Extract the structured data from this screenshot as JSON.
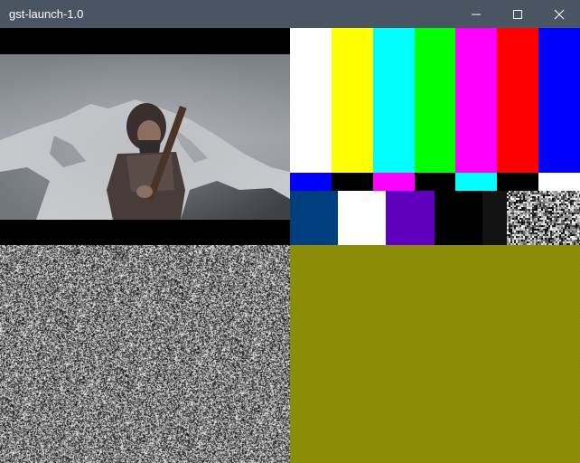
{
  "window": {
    "title": "gst-launch-1.0",
    "controls": [
      "minimize-icon",
      "maximize-icon",
      "close-icon"
    ]
  },
  "video_grid": {
    "top_left": {
      "content": "movie-frame",
      "letterbox": "black"
    },
    "top_right": {
      "content": "smpte-color-bars",
      "top_bars": [
        "#ffffff",
        "#ffff00",
        "#00ffff",
        "#00ff00",
        "#ff00ff",
        "#ff0000",
        "#0000ff"
      ],
      "middle_bars": [
        "#0000ff",
        "#000000",
        "#ff00ff",
        "#000000",
        "#00ffff",
        "#000000",
        "#ffffff"
      ],
      "bottom_bars": [
        "#003f7f",
        "#ffffff",
        "#5f00bf",
        "#000000",
        "#131313",
        "noise"
      ]
    },
    "bottom_left": {
      "content": "snow-noise"
    },
    "bottom_right": {
      "content": "checkers",
      "colors": [
        "#7f7f00",
        "#9a9a14"
      ]
    }
  }
}
